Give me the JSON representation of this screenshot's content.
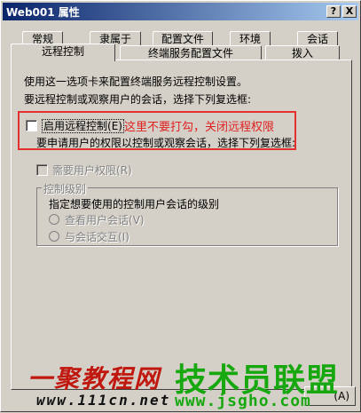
{
  "window": {
    "title": "Web001 属性",
    "help_btn": "?",
    "close_btn": "X"
  },
  "tabs_top": [
    "常规",
    "隶属于",
    "配置文件",
    "环境",
    "会话"
  ],
  "tabs_bottom": [
    "远程控制",
    "终端服务配置文件",
    "拨入"
  ],
  "active_tab": "远程控制",
  "content": {
    "description": "使用这一选项卡来配置终端服务远程控制设置。",
    "instruction": "要远程控制或观察用户的会话，选择下列复选框:",
    "enable_remote_control": {
      "label": "启用远程控制",
      "hotkey": "(E)",
      "checked": false
    },
    "enable_remote_control_desc": "要申请用户的权限以控制或观察会话，选择下列复选框:",
    "require_permission": {
      "label": "需要用户权限",
      "hotkey": "(R)",
      "checked": false
    },
    "control_level": {
      "legend": "控制级别",
      "prompt": "指定想要使用的控制用户会话的级别",
      "options": [
        {
          "label": "查看用户会话",
          "hotkey": "(V)"
        },
        {
          "label": "与会话交互",
          "hotkey": "(I)"
        }
      ]
    }
  },
  "annotation": "这里不要打勾，关闭远程权限",
  "watermark": {
    "brand1": "一聚教程网",
    "brand2": "技术员联盟",
    "url1": "www.111cn.net",
    "url2": "www.jsgho.com"
  },
  "footer": {
    "help_hotkey": "(A)"
  },
  "colors": {
    "annotation": "#e53030",
    "title_gradient_start": "#0a246a",
    "title_gradient_end": "#a6caf0"
  }
}
